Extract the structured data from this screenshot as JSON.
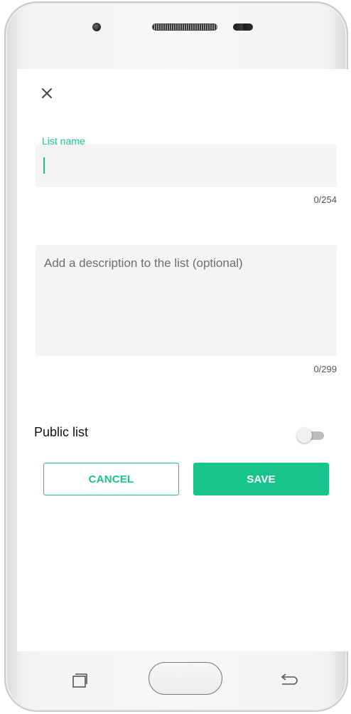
{
  "dialog": {
    "close_icon": "close-icon",
    "list_name": {
      "label": "List name",
      "value": "",
      "counter": "0/254"
    },
    "description": {
      "placeholder": "Add a description to the list (optional)",
      "value": "",
      "counter": "0/299"
    },
    "public_list": {
      "label": "Public list",
      "enabled": false
    },
    "buttons": {
      "cancel_label": "CANCEL",
      "save_label": "SAVE"
    }
  },
  "colors": {
    "accent": "#19c48c",
    "field_background": "#f4f4f4",
    "toggle_off_track": "#bdbdbd"
  },
  "navbar": {
    "recents_icon": "recents-icon",
    "home_button": "home-button",
    "back_icon": "back-icon"
  }
}
